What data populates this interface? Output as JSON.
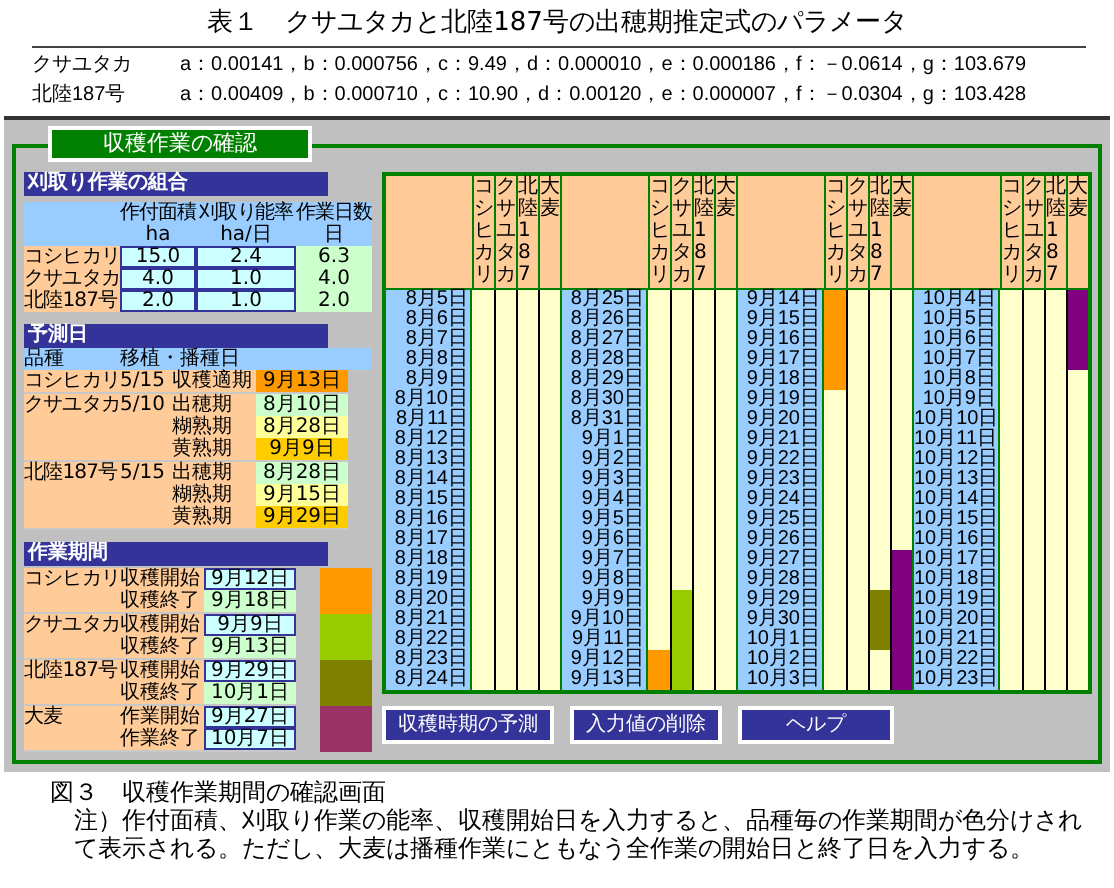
{
  "table": {
    "title": "表１　クサユタカと北陸187号の出穂期推定式のパラメータ",
    "rows": [
      {
        "variety": "クサユタカ",
        "params": "a：0.00141，b：0.000756，c：9.49，d：0.000010，e：0.000186，f：－0.0614，g：103.679"
      },
      {
        "variety": "北陸187号",
        "params": "a：0.00409，b：0.000710，c：10.90，d：0.00120，e：0.000007，f：－0.0304，g：103.428"
      }
    ]
  },
  "screen": {
    "title": "収穫作業の確認",
    "combination": {
      "title": "刈取り作業の組合",
      "columns": [
        {
          "label": "作付面積",
          "unit": "ha"
        },
        {
          "label": "刈取り能率",
          "unit": "ha/日"
        },
        {
          "label": "作業日数",
          "unit": "日"
        }
      ],
      "rows": [
        {
          "variety": "コシヒカリ",
          "area": "15.0",
          "rate": "2.4",
          "days": "6.3"
        },
        {
          "variety": "クサユタカ",
          "area": "4.0",
          "rate": "1.0",
          "days": "4.0"
        },
        {
          "variety": "北陸187号",
          "area": "2.0",
          "rate": "1.0",
          "days": "2.0"
        }
      ]
    },
    "forecast": {
      "title": "予測日",
      "columns": [
        "品種",
        "移植・播種日"
      ],
      "groups": [
        {
          "variety": "コシヒカリ",
          "date": "5/15",
          "stages": [
            {
              "kind": "harvest",
              "label": "収穫適期",
              "date": "9月13日"
            }
          ]
        },
        {
          "variety": "クサユタカ",
          "date": "5/10",
          "stages": [
            {
              "kind": "heading",
              "label": "出穂期",
              "date": "8月10日"
            },
            {
              "kind": "dough",
              "label": "糊熟期",
              "date": "8月28日"
            },
            {
              "kind": "yellow",
              "label": "黄熟期",
              "date": "9月9日"
            }
          ]
        },
        {
          "variety": "北陸187号",
          "date": "5/15",
          "stages": [
            {
              "kind": "heading",
              "label": "出穂期",
              "date": "8月28日"
            },
            {
              "kind": "dough",
              "label": "糊熟期",
              "date": "9月15日"
            },
            {
              "kind": "yellow",
              "label": "黄熟期",
              "date": "9月29日"
            }
          ]
        }
      ]
    },
    "periods": {
      "title": "作業期間",
      "groups": [
        {
          "variety": "コシヒカリ",
          "color": "#ff9900",
          "items": [
            {
              "kind": "input",
              "label": "収穫開始",
              "date": "9月12日"
            },
            {
              "kind": "computed",
              "label": "収穫終了",
              "date": "9月18日"
            }
          ]
        },
        {
          "variety": "クサユタカ",
          "color": "#99cc00",
          "items": [
            {
              "kind": "input",
              "label": "収穫開始",
              "date": "9月9日"
            },
            {
              "kind": "computed",
              "label": "収穫終了",
              "date": "9月13日"
            }
          ]
        },
        {
          "variety": "北陸187号",
          "color": "#808000",
          "items": [
            {
              "kind": "input",
              "label": "収穫開始",
              "date": "9月29日"
            },
            {
              "kind": "computed",
              "label": "収穫終了",
              "date": "10月1日"
            }
          ]
        },
        {
          "variety": "大麦",
          "color": "#993366",
          "items": [
            {
              "kind": "input",
              "label": "作業開始",
              "date": "9月27日"
            },
            {
              "kind": "input",
              "label": "作業終了",
              "date": "10月7日"
            }
          ]
        }
      ]
    },
    "gantt": {
      "crops": [
        {
          "color": "#ff9900"
        },
        {
          "color": "#99cc00"
        },
        {
          "color": "#808000"
        },
        {
          "color": "#800080"
        }
      ],
      "blocks": [
        {
          "headers": [
            "コシヒカリ",
            "クサユタカ",
            "北陸187",
            "大麦"
          ],
          "rows": [
            {
              "date": "8月5日",
              "filled": [
                false,
                false,
                false,
                false
              ]
            },
            {
              "date": "8月6日",
              "filled": [
                false,
                false,
                false,
                false
              ]
            },
            {
              "date": "8月7日",
              "filled": [
                false,
                false,
                false,
                false
              ]
            },
            {
              "date": "8月8日",
              "filled": [
                false,
                false,
                false,
                false
              ]
            },
            {
              "date": "8月9日",
              "filled": [
                false,
                false,
                false,
                false
              ]
            },
            {
              "date": "8月10日",
              "filled": [
                false,
                false,
                false,
                false
              ]
            },
            {
              "date": "8月11日",
              "filled": [
                false,
                false,
                false,
                false
              ]
            },
            {
              "date": "8月12日",
              "filled": [
                false,
                false,
                false,
                false
              ]
            },
            {
              "date": "8月13日",
              "filled": [
                false,
                false,
                false,
                false
              ]
            },
            {
              "date": "8月14日",
              "filled": [
                false,
                false,
                false,
                false
              ]
            },
            {
              "date": "8月15日",
              "filled": [
                false,
                false,
                false,
                false
              ]
            },
            {
              "date": "8月16日",
              "filled": [
                false,
                false,
                false,
                false
              ]
            },
            {
              "date": "8月17日",
              "filled": [
                false,
                false,
                false,
                false
              ]
            },
            {
              "date": "8月18日",
              "filled": [
                false,
                false,
                false,
                false
              ]
            },
            {
              "date": "8月19日",
              "filled": [
                false,
                false,
                false,
                false
              ]
            },
            {
              "date": "8月20日",
              "filled": [
                false,
                false,
                false,
                false
              ]
            },
            {
              "date": "8月21日",
              "filled": [
                false,
                false,
                false,
                false
              ]
            },
            {
              "date": "8月22日",
              "filled": [
                false,
                false,
                false,
                false
              ]
            },
            {
              "date": "8月23日",
              "filled": [
                false,
                false,
                false,
                false
              ]
            },
            {
              "date": "8月24日",
              "filled": [
                false,
                false,
                false,
                false
              ]
            }
          ]
        },
        {
          "headers": [
            "コシヒカリ",
            "クサユタカ",
            "北陸187",
            "大麦"
          ],
          "rows": [
            {
              "date": "8月25日",
              "filled": [
                false,
                false,
                false,
                false
              ]
            },
            {
              "date": "8月26日",
              "filled": [
                false,
                false,
                false,
                false
              ]
            },
            {
              "date": "8月27日",
              "filled": [
                false,
                false,
                false,
                false
              ]
            },
            {
              "date": "8月28日",
              "filled": [
                false,
                false,
                false,
                false
              ]
            },
            {
              "date": "8月29日",
              "filled": [
                false,
                false,
                false,
                false
              ]
            },
            {
              "date": "8月30日",
              "filled": [
                false,
                false,
                false,
                false
              ]
            },
            {
              "date": "8月31日",
              "filled": [
                false,
                false,
                false,
                false
              ]
            },
            {
              "date": "9月1日",
              "filled": [
                false,
                false,
                false,
                false
              ]
            },
            {
              "date": "9月2日",
              "filled": [
                false,
                false,
                false,
                false
              ]
            },
            {
              "date": "9月3日",
              "filled": [
                false,
                false,
                false,
                false
              ]
            },
            {
              "date": "9月4日",
              "filled": [
                false,
                false,
                false,
                false
              ]
            },
            {
              "date": "9月5日",
              "filled": [
                false,
                false,
                false,
                false
              ]
            },
            {
              "date": "9月6日",
              "filled": [
                false,
                false,
                false,
                false
              ]
            },
            {
              "date": "9月7日",
              "filled": [
                false,
                false,
                false,
                false
              ]
            },
            {
              "date": "9月8日",
              "filled": [
                false,
                false,
                false,
                false
              ]
            },
            {
              "date": "9月9日",
              "filled": [
                false,
                true,
                false,
                false
              ]
            },
            {
              "date": "9月10日",
              "filled": [
                false,
                true,
                false,
                false
              ]
            },
            {
              "date": "9月11日",
              "filled": [
                false,
                true,
                false,
                false
              ]
            },
            {
              "date": "9月12日",
              "filled": [
                true,
                true,
                false,
                false
              ]
            },
            {
              "date": "9月13日",
              "filled": [
                true,
                true,
                false,
                false
              ]
            }
          ]
        },
        {
          "headers": [
            "コシヒカリ",
            "クサユタカ",
            "北陸187",
            "大麦"
          ],
          "rows": [
            {
              "date": "9月14日",
              "filled": [
                true,
                false,
                false,
                false
              ]
            },
            {
              "date": "9月15日",
              "filled": [
                true,
                false,
                false,
                false
              ]
            },
            {
              "date": "9月16日",
              "filled": [
                true,
                false,
                false,
                false
              ]
            },
            {
              "date": "9月17日",
              "filled": [
                true,
                false,
                false,
                false
              ]
            },
            {
              "date": "9月18日",
              "filled": [
                true,
                false,
                false,
                false
              ]
            },
            {
              "date": "9月19日",
              "filled": [
                false,
                false,
                false,
                false
              ]
            },
            {
              "date": "9月20日",
              "filled": [
                false,
                false,
                false,
                false
              ]
            },
            {
              "date": "9月21日",
              "filled": [
                false,
                false,
                false,
                false
              ]
            },
            {
              "date": "9月22日",
              "filled": [
                false,
                false,
                false,
                false
              ]
            },
            {
              "date": "9月23日",
              "filled": [
                false,
                false,
                false,
                false
              ]
            },
            {
              "date": "9月24日",
              "filled": [
                false,
                false,
                false,
                false
              ]
            },
            {
              "date": "9月25日",
              "filled": [
                false,
                false,
                false,
                false
              ]
            },
            {
              "date": "9月26日",
              "filled": [
                false,
                false,
                false,
                false
              ]
            },
            {
              "date": "9月27日",
              "filled": [
                false,
                false,
                false,
                true
              ]
            },
            {
              "date": "9月28日",
              "filled": [
                false,
                false,
                false,
                true
              ]
            },
            {
              "date": "9月29日",
              "filled": [
                false,
                false,
                true,
                true
              ]
            },
            {
              "date": "9月30日",
              "filled": [
                false,
                false,
                true,
                true
              ]
            },
            {
              "date": "10月1日",
              "filled": [
                false,
                false,
                true,
                true
              ]
            },
            {
              "date": "10月2日",
              "filled": [
                false,
                false,
                false,
                true
              ]
            },
            {
              "date": "10月3日",
              "filled": [
                false,
                false,
                false,
                true
              ]
            }
          ]
        },
        {
          "headers": [
            "コシヒカリ",
            "クサユタカ",
            "北陸187",
            "大麦"
          ],
          "rows": [
            {
              "date": "10月4日",
              "filled": [
                false,
                false,
                false,
                true
              ]
            },
            {
              "date": "10月5日",
              "filled": [
                false,
                false,
                false,
                true
              ]
            },
            {
              "date": "10月6日",
              "filled": [
                false,
                false,
                false,
                true
              ]
            },
            {
              "date": "10月7日",
              "filled": [
                false,
                false,
                false,
                true
              ]
            },
            {
              "date": "10月8日",
              "filled": [
                false,
                false,
                false,
                false
              ]
            },
            {
              "date": "10月9日",
              "filled": [
                false,
                false,
                false,
                false
              ]
            },
            {
              "date": "10月10日",
              "filled": [
                false,
                false,
                false,
                false
              ]
            },
            {
              "date": "10月11日",
              "filled": [
                false,
                false,
                false,
                false
              ]
            },
            {
              "date": "10月12日",
              "filled": [
                false,
                false,
                false,
                false
              ]
            },
            {
              "date": "10月13日",
              "filled": [
                false,
                false,
                false,
                false
              ]
            },
            {
              "date": "10月14日",
              "filled": [
                false,
                false,
                false,
                false
              ]
            },
            {
              "date": "10月15日",
              "filled": [
                false,
                false,
                false,
                false
              ]
            },
            {
              "date": "10月16日",
              "filled": [
                false,
                false,
                false,
                false
              ]
            },
            {
              "date": "10月17日",
              "filled": [
                false,
                false,
                false,
                false
              ]
            },
            {
              "date": "10月18日",
              "filled": [
                false,
                false,
                false,
                false
              ]
            },
            {
              "date": "10月19日",
              "filled": [
                false,
                false,
                false,
                false
              ]
            },
            {
              "date": "10月20日",
              "filled": [
                false,
                false,
                false,
                false
              ]
            },
            {
              "date": "10月21日",
              "filled": [
                false,
                false,
                false,
                false
              ]
            },
            {
              "date": "10月22日",
              "filled": [
                false,
                false,
                false,
                false
              ]
            },
            {
              "date": "10月23日",
              "filled": [
                false,
                false,
                false,
                false
              ]
            }
          ]
        }
      ]
    },
    "buttons": [
      "収穫時期の予測",
      "入力値の削除",
      "ヘルプ"
    ]
  },
  "caption": {
    "title": "図３　収穫作業期間の確認画面",
    "note": "注）作付面積、刈取り作業の能率、収穫開始日を入力すると、品種毎の作業期間が色分けされて表示される。ただし、大麦は播種作業にともなう全作業の開始日と終了日を入力する。"
  }
}
